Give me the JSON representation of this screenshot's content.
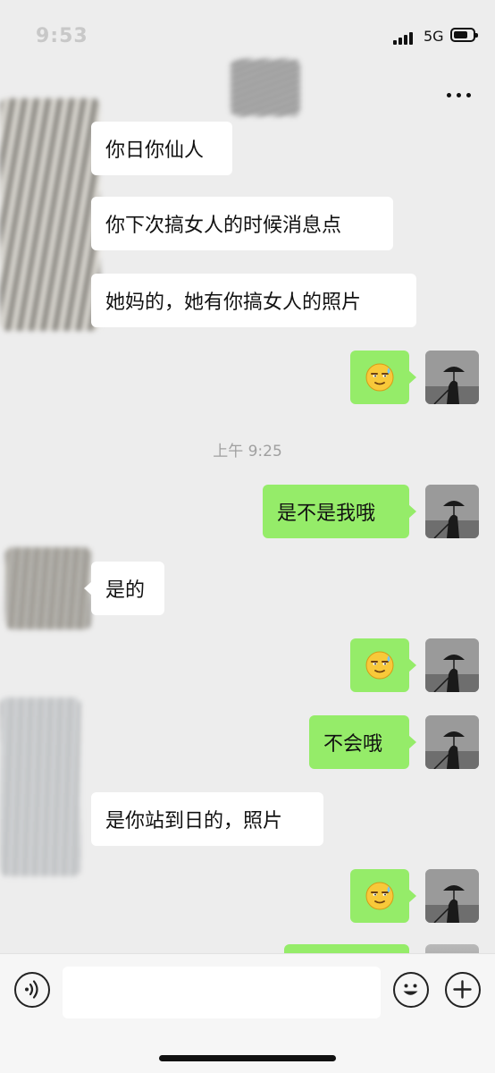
{
  "status_bar": {
    "time": "9:53",
    "network": "5G"
  },
  "header": {
    "more_icon": "more-dots-icon"
  },
  "messages": [
    {
      "side": "in",
      "text": "你日你仙人"
    },
    {
      "side": "in",
      "text": "你下次搞女人的时候消息点"
    },
    {
      "side": "in",
      "text": "她妈的，她有你搞女人的照片"
    },
    {
      "side": "out",
      "emoji": "sweat-smile-emoji"
    },
    {
      "side": "out",
      "text": "是不是我哦"
    },
    {
      "side": "in",
      "text": "是的"
    },
    {
      "side": "out",
      "emoji": "sweat-smile-emoji"
    },
    {
      "side": "out",
      "text": "不会哦"
    },
    {
      "side": "in",
      "text": "是你站到日的，照片"
    },
    {
      "side": "out",
      "emoji": "sweat-smile-emoji"
    }
  ],
  "timestamp": "上午 9:25",
  "input_bar": {
    "voice_icon": "voice-icon",
    "emoji_icon": "emoji-icon",
    "add_icon": "plus-icon",
    "text": ""
  },
  "colors": {
    "background": "#ededed",
    "incoming_bubble": "#ffffff",
    "outgoing_bubble": "#95ec69"
  }
}
